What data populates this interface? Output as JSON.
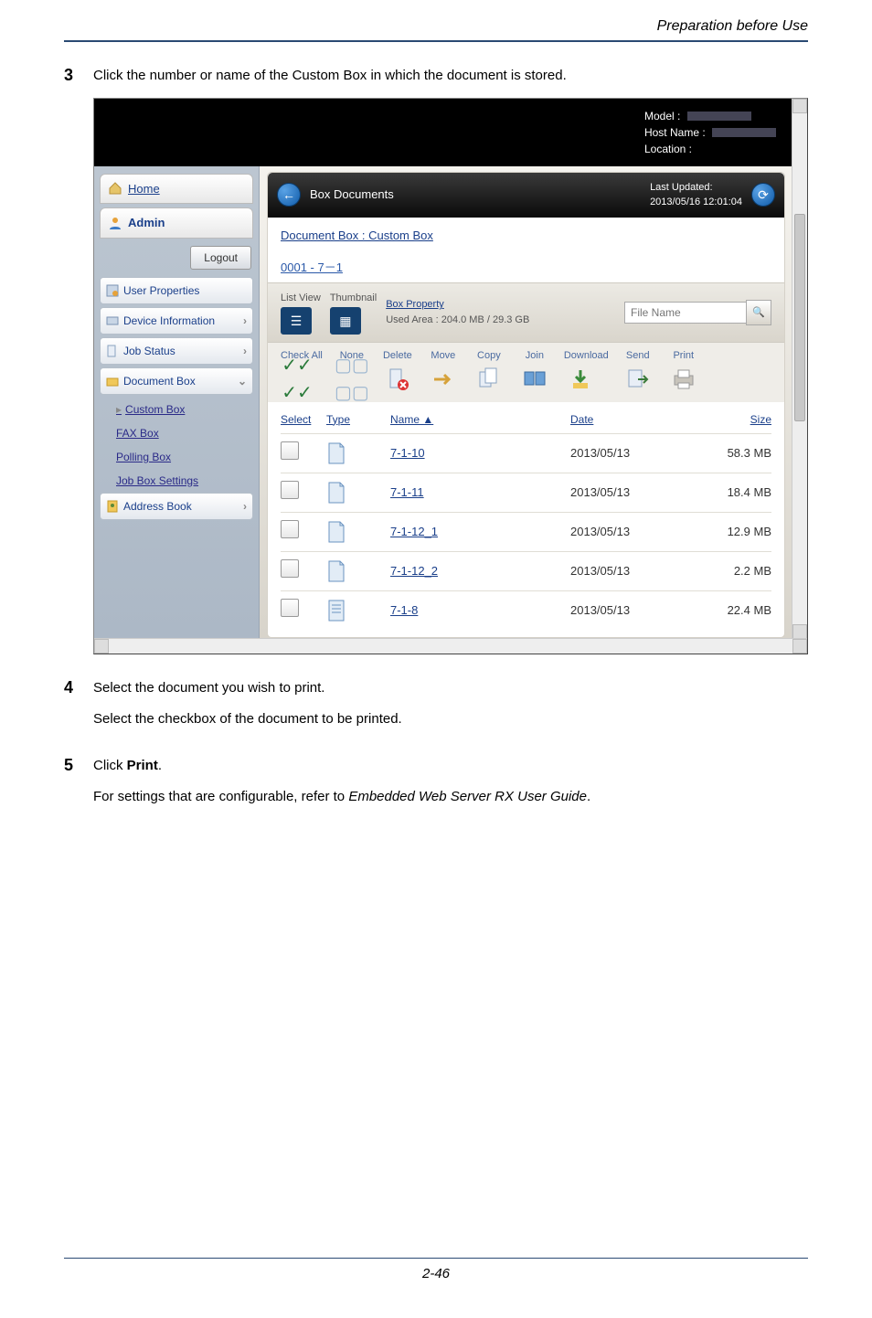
{
  "header_title": "Preparation before Use",
  "steps": {
    "s3": {
      "num": "3",
      "text": "Click the number or name of the Custom Box in which the document is stored."
    },
    "s4": {
      "num": "4",
      "text_a": "Select the document you wish to print.",
      "text_b": "Select the checkbox of the document to be printed."
    },
    "s5": {
      "num": "5",
      "text_a_prefix": "Click ",
      "text_a_bold": "Print",
      "text_a_suffix": ".",
      "text_b_prefix": "For settings that are configurable, refer to ",
      "text_b_italic": "Embedded Web Server RX User Guide",
      "text_b_suffix": "."
    }
  },
  "banner": {
    "model_label": "Model :",
    "host_label": "Host Name :",
    "location_label": "Location :"
  },
  "sidebar": {
    "home": "Home",
    "admin": "Admin",
    "logout": "Logout",
    "user_properties": "User Properties",
    "device_info": "Device Information",
    "job_status": "Job Status",
    "document_box": "Document Box",
    "custom_box": "Custom Box",
    "fax_box": "FAX Box",
    "polling_box": "Polling Box",
    "job_box_settings": "Job Box Settings",
    "address_book": "Address Book"
  },
  "main": {
    "head_title": "Box Documents",
    "last_updated_label": "Last Updated:",
    "last_updated_value": "2013/05/16 12:01:04",
    "crumb": "Document Box : Custom Box",
    "box_link": "0001 - 7－1",
    "ctrl": {
      "list_view": "List View",
      "thumbnail": "Thumbnail",
      "box_property": "Box Property",
      "used_area": "Used Area : 204.0 MB / 29.3 GB",
      "file_name_placeholder": "File Name"
    },
    "actions": {
      "check_all": "Check All",
      "none": "None",
      "delete": "Delete",
      "move": "Move",
      "copy": "Copy",
      "join": "Join",
      "download": "Download",
      "send": "Send",
      "print": "Print"
    },
    "table": {
      "headers": {
        "select": "Select",
        "type": "Type",
        "name": "Name",
        "date": "Date",
        "size": "Size"
      },
      "rows": [
        {
          "name": "7-1-10",
          "date": "2013/05/13",
          "size": "58.3 MB"
        },
        {
          "name": "7-1-11",
          "date": "2013/05/13",
          "size": "18.4 MB"
        },
        {
          "name": "7-1-12_1",
          "date": "2013/05/13",
          "size": "12.9 MB"
        },
        {
          "name": "7-1-12_2",
          "date": "2013/05/13",
          "size": "2.2 MB"
        },
        {
          "name": "7-1-8",
          "date": "2013/05/13",
          "size": "22.4 MB"
        }
      ]
    }
  },
  "footer": "2-46"
}
